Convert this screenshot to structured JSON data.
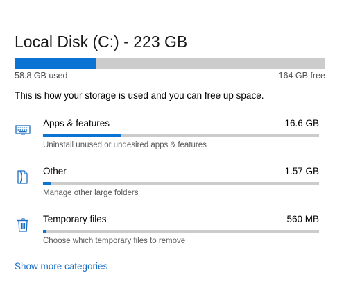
{
  "disk": {
    "title": "Local Disk (C:) - 223 GB",
    "used_label": "58.8 GB used",
    "free_label": "164 GB free",
    "used_fraction": 0.264
  },
  "intro_text": "This is how your storage is used and you can free up space.",
  "categories": [
    {
      "name": "Apps & features",
      "size": "16.6 GB",
      "description": "Uninstall unused or undesired apps & features",
      "icon": "keyboard-icon",
      "usage_fraction": 0.285
    },
    {
      "name": "Other",
      "size": "1.57 GB",
      "description": "Manage other large folders",
      "icon": "document-icon",
      "usage_fraction": 0.027
    },
    {
      "name": "Temporary files",
      "size": "560 MB",
      "description": "Choose which temporary files to remove",
      "icon": "trash-icon",
      "usage_fraction": 0.01
    }
  ],
  "show_more_label": "Show more categories",
  "colors": {
    "accent": "#0a73d4",
    "bar_track": "#cccccc",
    "link": "#1a6dc1"
  }
}
